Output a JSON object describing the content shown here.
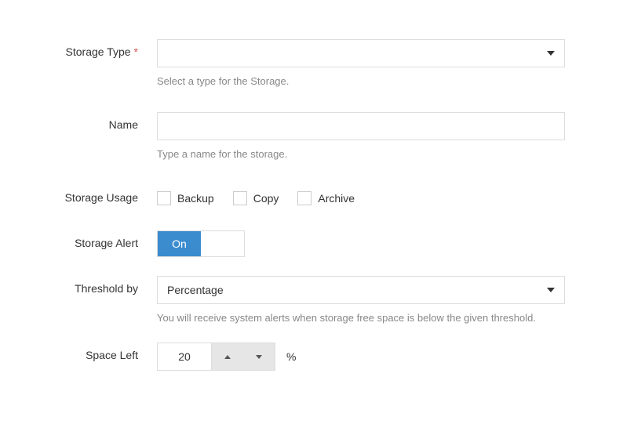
{
  "storageType": {
    "label": "Storage Type",
    "value": "",
    "help": "Select a type for the Storage."
  },
  "name": {
    "label": "Name",
    "value": "",
    "help": "Type a name for the storage."
  },
  "storageUsage": {
    "label": "Storage Usage",
    "options": [
      {
        "label": "Backup"
      },
      {
        "label": "Copy"
      },
      {
        "label": "Archive"
      }
    ]
  },
  "storageAlert": {
    "label": "Storage Alert",
    "on": "On"
  },
  "thresholdBy": {
    "label": "Threshold by",
    "value": "Percentage",
    "help": "You will receive system alerts when storage free space is below the given threshold."
  },
  "spaceLeft": {
    "label": "Space Left",
    "value": "20",
    "unit": "%"
  }
}
